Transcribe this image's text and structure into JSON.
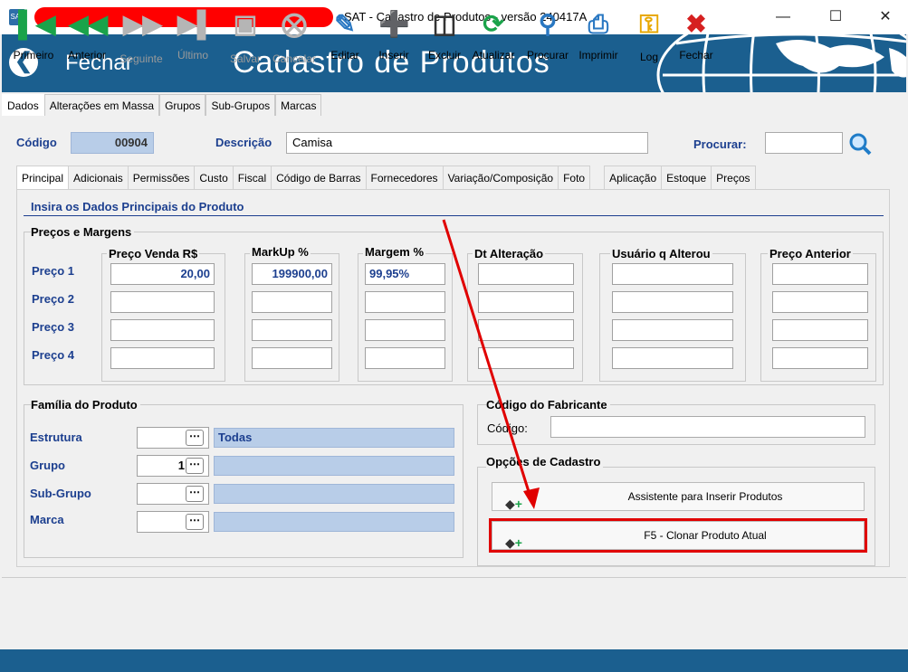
{
  "window": {
    "title": "- SAT - Cadastro de Produtos - versão 240417A"
  },
  "header": {
    "back_label": "Fechar",
    "title": "Cadastro de Produtos"
  },
  "top_tabs": [
    "Dados",
    "Alterações em Massa",
    "Grupos",
    "Sub-Grupos",
    "Marcas"
  ],
  "product": {
    "codigo_label": "Código",
    "codigo_value": "00904",
    "descricao_label": "Descrição",
    "descricao_value": "Camisa",
    "procurar_label": "Procurar:",
    "procurar_value": ""
  },
  "sub_tabs": [
    "Principal",
    "Adicionais",
    "Permissões",
    "Custo",
    "Fiscal",
    "Código de Barras",
    "Fornecedores",
    "Variação/Composição",
    "Foto",
    "Aplicação",
    "Estoque",
    "Preços"
  ],
  "section_title": "Insira os Dados Principais do Produto",
  "precos": {
    "group_title": "Preços e Margens",
    "headers": [
      "Preço Venda R$",
      "MarkUp %",
      "Margem %",
      "Dt Alteração",
      "Usuário q Alterou",
      "Preço Anterior"
    ],
    "rows": [
      {
        "label": "Preço 1",
        "venda": "20,00",
        "markup": "199900,00",
        "margem": "99,95%"
      },
      {
        "label": "Preço 2",
        "venda": "",
        "markup": "",
        "margem": ""
      },
      {
        "label": "Preço 3",
        "venda": "",
        "markup": "",
        "margem": ""
      },
      {
        "label": "Preço 4",
        "venda": "",
        "markup": "",
        "margem": ""
      }
    ]
  },
  "familia": {
    "group_title": "Família do Produto",
    "rows": [
      {
        "label": "Estrutura",
        "code": "",
        "desc": "Todas"
      },
      {
        "label": "Grupo",
        "code": "1",
        "desc": ""
      },
      {
        "label": "Sub-Grupo",
        "code": "",
        "desc": ""
      },
      {
        "label": "Marca",
        "code": "",
        "desc": ""
      }
    ]
  },
  "fabricante": {
    "group_title": "Código do Fabricante",
    "codigo_label": "Código:",
    "codigo_value": ""
  },
  "opcoes": {
    "group_title": "Opções de Cadastro",
    "assistente_label": "Assistente para Inserir Produtos",
    "clonar_label": "F5 - Clonar Produto Atual"
  },
  "toolbar": [
    {
      "label": "Primeiro",
      "icon": "first-icon"
    },
    {
      "label": "Anterior",
      "icon": "previous-icon"
    },
    {
      "label": "Seguinte",
      "icon": "next-icon"
    },
    {
      "label": "Último",
      "icon": "last-icon"
    },
    {
      "label": "Salvar",
      "icon": "save-icon"
    },
    {
      "label": "Cancelar",
      "icon": "cancel-icon"
    },
    {
      "label": "Editar",
      "icon": "edit-icon"
    },
    {
      "label": "Inserir",
      "icon": "insert-icon"
    },
    {
      "label": "Excluir",
      "icon": "trash-icon"
    },
    {
      "label": "Atualizar",
      "icon": "refresh-icon"
    },
    {
      "label": "Procurar",
      "icon": "search-icon"
    },
    {
      "label": "Imprimir",
      "icon": "print-icon"
    },
    {
      "label": "Log",
      "icon": "key-icon"
    },
    {
      "label": "Fechar",
      "icon": "close-icon"
    }
  ],
  "colors": {
    "header": "#1b5f8f",
    "label_blue": "#1c3f8f",
    "highlight": "#e00000",
    "nav_green": "#1aa34a"
  }
}
